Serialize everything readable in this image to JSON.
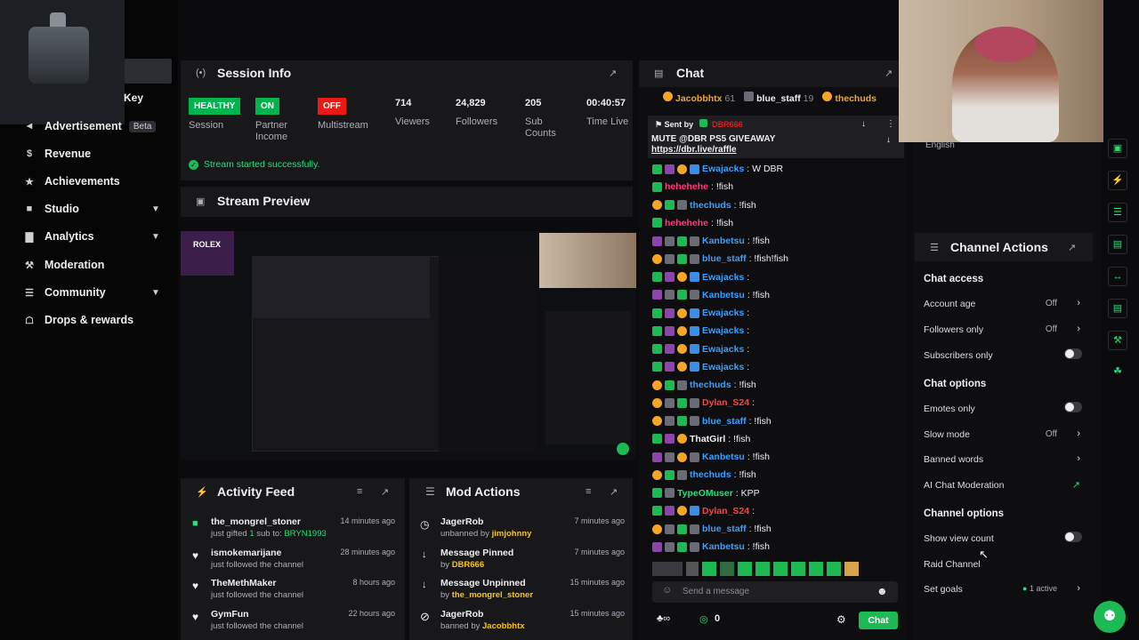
{
  "sidebar": {
    "partial_key_label": "Key",
    "items": [
      {
        "label": "Advertisement",
        "badge": "Beta",
        "icon": "megaphone-icon"
      },
      {
        "label": "Revenue",
        "icon": "dollar-icon"
      },
      {
        "label": "Achievements",
        "icon": "trophy-icon"
      },
      {
        "label": "Studio",
        "icon": "film-icon"
      },
      {
        "label": "Analytics",
        "icon": "chart-icon"
      },
      {
        "label": "Moderation",
        "icon": "wrench-icon"
      },
      {
        "label": "Community",
        "icon": "users-icon"
      },
      {
        "label": "Drops & rewards",
        "icon": "gift-icon"
      }
    ]
  },
  "session": {
    "title": "Session Info",
    "health_badge": "HEALTHY",
    "health_label": "Session",
    "partner_badge": "ON",
    "partner_label": "Partner Income",
    "multi_badge": "OFF",
    "multi_label": "Multistream",
    "viewers_val": "714",
    "viewers_label": "Viewers",
    "followers_val": "24,829",
    "followers_label": "Followers",
    "subs_val": "205",
    "subs_label": "Sub Counts",
    "time_val": "00:40:57",
    "time_label": "Time Live",
    "status": "Stream started successfully."
  },
  "preview": {
    "title": "Stream Preview",
    "logo_text": "ROLEX"
  },
  "activity": {
    "title": "Activity Feed",
    "items": [
      {
        "name": "the_mongrel_stoner",
        "sub_pre": "just gifted ",
        "sub_count": "1",
        "sub_mid": " sub to: ",
        "sub_user": "BRYN1993",
        "time": "14 minutes ago"
      },
      {
        "name": "ismokemarijane",
        "sub": "just followed the channel",
        "time": "28 minutes ago"
      },
      {
        "name": "TheMethMaker",
        "sub": "just followed the channel",
        "time": "8 hours ago"
      },
      {
        "name": "GymFun",
        "sub": "just followed the channel",
        "time": "22 hours ago"
      }
    ]
  },
  "modactions": {
    "title": "Mod Actions",
    "items": [
      {
        "name": "JagerRob",
        "sub_pre": "unbanned by ",
        "sub_user": "jimjohnny",
        "time": "7 minutes ago"
      },
      {
        "name": "Message Pinned",
        "sub_pre": "by ",
        "sub_user": "DBR666",
        "time": "7 minutes ago"
      },
      {
        "name": "Message Unpinned",
        "sub_pre": "by ",
        "sub_user": "the_mongrel_stoner",
        "time": "15 minutes ago"
      },
      {
        "name": "JagerRob",
        "sub_pre": "banned by ",
        "sub_user": "Jacobbhtx",
        "time": "15 minutes ago"
      }
    ]
  },
  "chat": {
    "title": "Chat",
    "top_chatters": [
      {
        "name": "Jacobbhtx",
        "count": "61"
      },
      {
        "name": "blue_staff",
        "count": "19"
      },
      {
        "name": "thechuds",
        "count": ""
      }
    ],
    "pinned_by_label": "Sent by",
    "pinned_by_user": "DBR666",
    "pinned_text": "MUTE @DBR PS5 GIVEAWAY",
    "pinned_link": "https://dbr.live/raffle",
    "messages": [
      {
        "user": "Ewajacks",
        "color": "#3aa0ff",
        "text": ": W DBR"
      },
      {
        "user": "hehehehe",
        "color": "#ff3b7a",
        "text": ": !fish"
      },
      {
        "user": "thechuds",
        "color": "#3aa0ff",
        "text": ": !fish"
      },
      {
        "user": "hehehehe",
        "color": "#ff3b7a",
        "text": ": !fish"
      },
      {
        "user": "Kanbetsu",
        "color": "#3aa0ff",
        "text": ": !fish"
      },
      {
        "user": "blue_staff",
        "color": "#3aa0ff",
        "text": ": !fish!fish"
      },
      {
        "user": "Ewajacks",
        "color": "#3aa0ff",
        "text": ":"
      },
      {
        "user": "Kanbetsu",
        "color": "#3aa0ff",
        "text": ": !fish"
      },
      {
        "user": "Ewajacks",
        "color": "#3aa0ff",
        "text": ":"
      },
      {
        "user": "Ewajacks",
        "color": "#3aa0ff",
        "text": ":"
      },
      {
        "user": "Ewajacks",
        "color": "#3aa0ff",
        "text": ":"
      },
      {
        "user": "Ewajacks",
        "color": "#3aa0ff",
        "text": ":"
      },
      {
        "user": "thechuds",
        "color": "#3aa0ff",
        "text": ": !fish"
      },
      {
        "user": "Dylan_S24",
        "color": "#ff4040",
        "text": ":"
      },
      {
        "user": "blue_staff",
        "color": "#3aa0ff",
        "text": ": !fish"
      },
      {
        "user": "ThatGirl",
        "color": "#efeff1",
        "text": ": !fish"
      },
      {
        "user": "Kanbetsu",
        "color": "#3aa0ff",
        "text": ": !fish"
      },
      {
        "user": "thechuds",
        "color": "#3aa0ff",
        "text": ": !fish"
      },
      {
        "user": "TypeOMuser",
        "color": "#1de37a",
        "text": ": KPP"
      },
      {
        "user": "Dylan_S24",
        "color": "#ff4040",
        "text": ":"
      },
      {
        "user": "blue_staff",
        "color": "#3aa0ff",
        "text": ": !fish"
      },
      {
        "user": "Kanbetsu",
        "color": "#3aa0ff",
        "text": ": !fish"
      }
    ],
    "input_placeholder": "Send a message",
    "points": "0",
    "send_label": "Chat"
  },
  "right": {
    "language": "English",
    "title": "Channel Actions",
    "chat_access": "Chat access",
    "account_age": "Account age",
    "account_age_val": "Off",
    "followers_only": "Followers only",
    "followers_only_val": "Off",
    "subscribers_only": "Subscribers only",
    "chat_options": "Chat options",
    "emotes_only": "Emotes only",
    "slow_mode": "Slow mode",
    "slow_mode_val": "Off",
    "banned_words": "Banned words",
    "ai_moderation": "AI Chat Moderation",
    "channel_options": "Channel options",
    "show_view_count": "Show view count",
    "raid_channel": "Raid Channel",
    "set_goals": "Set goals",
    "goals_val": "1 active"
  },
  "colors": {
    "accent": "#1db954",
    "danger": "#e91916",
    "panel": "#18181b"
  }
}
